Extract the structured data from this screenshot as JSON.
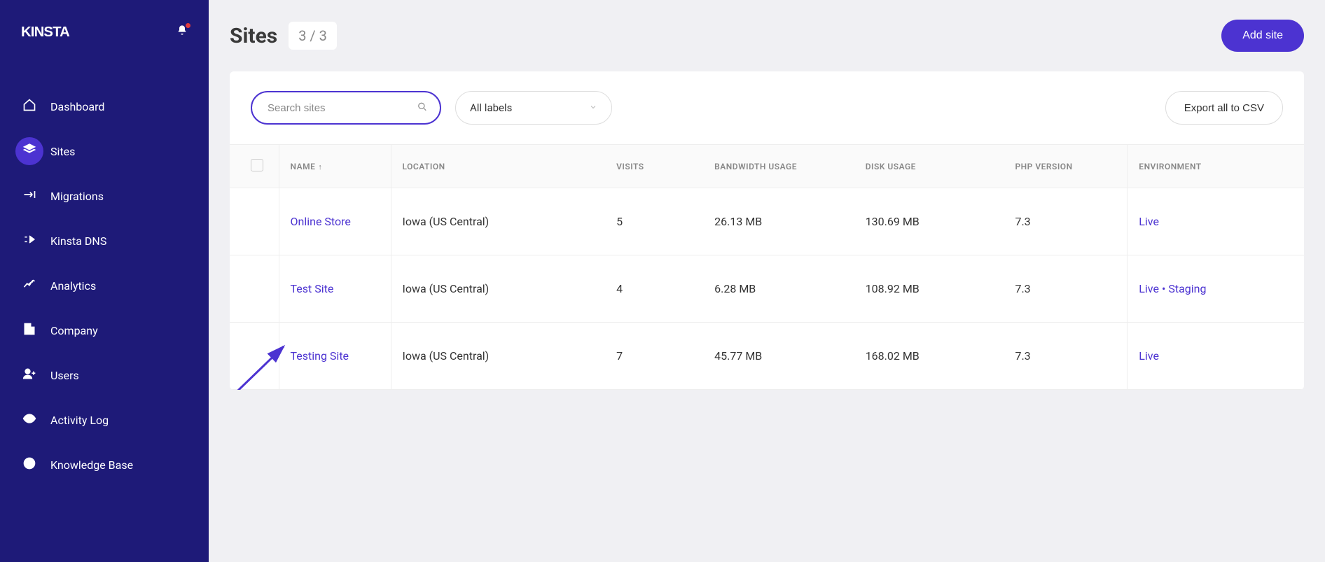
{
  "brand": "KINSTA",
  "sidebar": {
    "items": [
      {
        "label": "Dashboard"
      },
      {
        "label": "Sites"
      },
      {
        "label": "Migrations"
      },
      {
        "label": "Kinsta DNS"
      },
      {
        "label": "Analytics"
      },
      {
        "label": "Company"
      },
      {
        "label": "Users"
      },
      {
        "label": "Activity Log"
      },
      {
        "label": "Knowledge Base"
      }
    ]
  },
  "header": {
    "title": "Sites",
    "count": "3 / 3",
    "add_button": "Add site"
  },
  "toolbar": {
    "search_placeholder": "Search sites",
    "labels_select": "All labels",
    "export_button": "Export all to CSV"
  },
  "table": {
    "columns": {
      "name": "NAME",
      "location": "LOCATION",
      "visits": "VISITS",
      "bandwidth": "BANDWIDTH USAGE",
      "disk": "DISK USAGE",
      "php": "PHP VERSION",
      "env": "ENVIRONMENT"
    },
    "rows": [
      {
        "name": "Online Store",
        "location": "Iowa (US Central)",
        "visits": "5",
        "bandwidth": "26.13 MB",
        "disk": "130.69 MB",
        "php": "7.3",
        "env": [
          "Live"
        ]
      },
      {
        "name": "Test Site",
        "location": "Iowa (US Central)",
        "visits": "4",
        "bandwidth": "6.28 MB",
        "disk": "108.92 MB",
        "php": "7.3",
        "env": [
          "Live",
          "Staging"
        ]
      },
      {
        "name": "Testing Site",
        "location": "Iowa (US Central)",
        "visits": "7",
        "bandwidth": "45.77 MB",
        "disk": "168.02 MB",
        "php": "7.3",
        "env": [
          "Live"
        ]
      }
    ]
  },
  "colors": {
    "accent": "#4c33d1",
    "sidebar_bg": "#1e1a78"
  }
}
